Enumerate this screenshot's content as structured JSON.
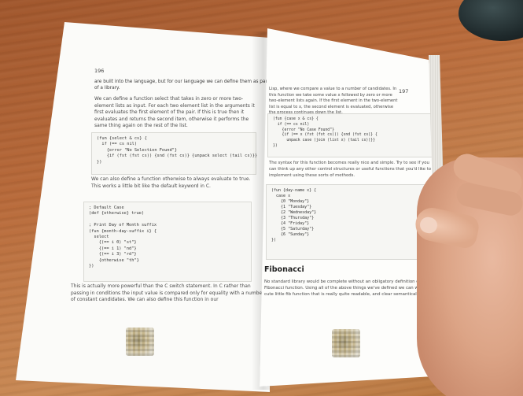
{
  "left_page": {
    "page_number": "196",
    "line_1": "are built into the language, but for our language we can define them as part",
    "line_2": "of a library.",
    "para_1": "We can define a function select that takes in zero or more two-element lists as input. For each two element list in the arguments it first evaluates the first element of the pair. If this is true then it evaluates and returns the second item, otherwise it performs the same thing again on the rest of the list.",
    "code_1": "(fun {select & cs} {\n  if (== cs nil)\n    {error \"No Selection Found\"}\n    {if (fst (fst cs)) {snd (fst cs)} {unpack select (tail cs)}}\n})",
    "para_2": "We can also define a function otherwise to always evaluate to true. This works a little bit like the default keyword in C.",
    "code_2": "; Default Case\n(def {otherwise} true)\n\n; Print Day of Month suffix\n(fun {month-day-suffix i} {\n  select\n    {(== i 0) \"st\"}\n    {(== i 1) \"nd\"}\n    {(== i 3) \"rd\"}\n    {otherwise \"th\"}\n})",
    "para_3": "This is actually more powerful than the C switch statement. In C rather than passing in conditions the input value is compared only for equality with a number of constant candidates. We can also define this function in our"
  },
  "right_page": {
    "page_number": "197",
    "para_1": "Lisp, where we compare a value to a number of candidates. In this function we take some value x followed by zero or more two-element lists again. If the first element in the two-element list is equal to x, the second element is evaluated, otherwise the process continues down the list.",
    "code_1": "(fun {case x & cs} {\n  if (== cs nil)\n    {error \"No Case Found\"}\n    {if (== x (fst (fst cs))) {snd (fst cs)} {\n      unpack case (join (list x) (tail cs))}}\n})",
    "para_2": "The syntax for this function becomes really nice and simple. Try to see if you can think up any other control structures or useful functions that you'd like to implement using these sorts of methods.",
    "code_2": "(fun {day-name x} {\n  case x\n    {0 \"Monday\"}\n    {1 \"Tuesday\"}\n    {2 \"Wednesday\"}\n    {3 \"Thursday\"}\n    {4 \"Friday\"}\n    {5 \"Saturday\"}\n    {6 \"Sunday\"}\n})",
    "heading": "Fibonacci",
    "para_3": "No standard library would be complete without an obligatory definition of the Fibonacci function. Using all of the above things we've defined we can write a cute little fib function that is really quite readable, and clear semantically."
  },
  "colors": {
    "table_wood": "#b86a3a",
    "paper": "#fbfbf9",
    "keyword": "#2b3f8f"
  }
}
